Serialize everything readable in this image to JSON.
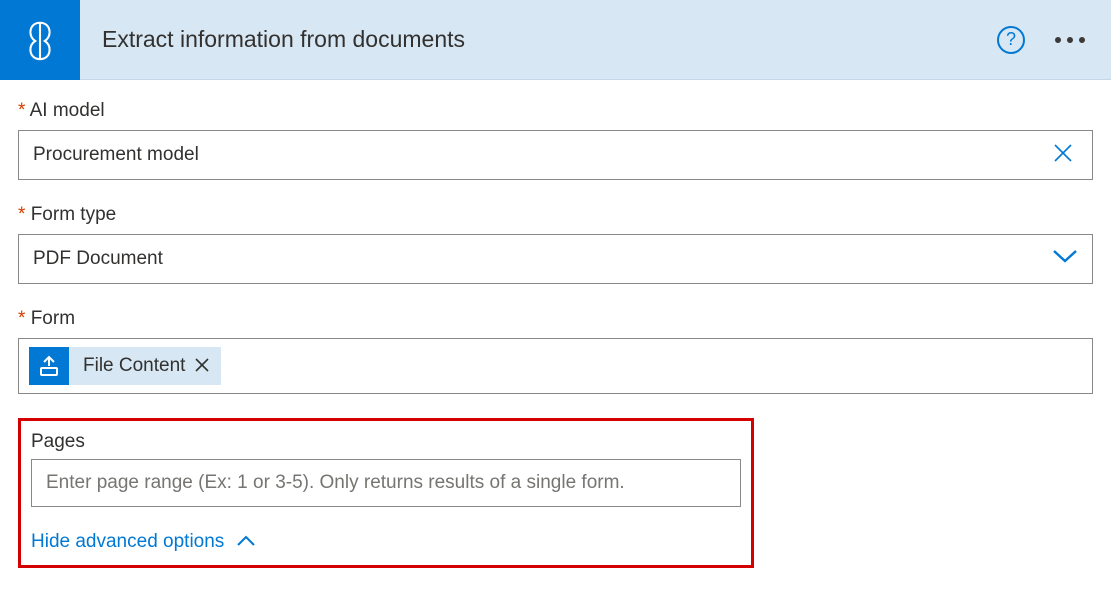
{
  "header": {
    "title": "Extract information from documents"
  },
  "fields": {
    "ai_model": {
      "label": "AI model",
      "value": "Procurement model"
    },
    "form_type": {
      "label": "Form type",
      "value": "PDF Document"
    },
    "form": {
      "label": "Form",
      "token": "File Content"
    },
    "pages": {
      "label": "Pages",
      "placeholder": "Enter page range (Ex: 1 or 3-5). Only returns results of a single form."
    }
  },
  "toggle": {
    "label": "Hide advanced options"
  }
}
